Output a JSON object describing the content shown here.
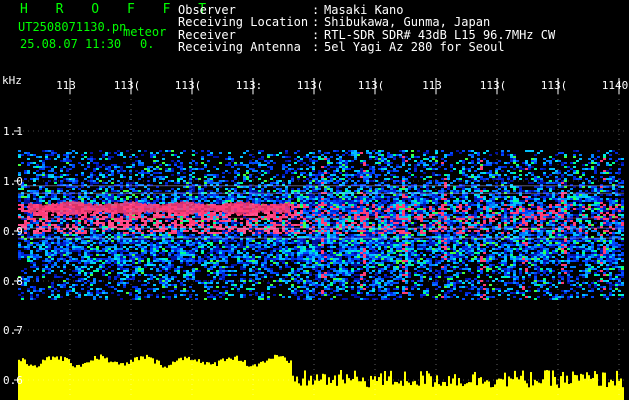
{
  "header": {
    "brand": "H R O F F T",
    "file_id": "UT2508071130.pn",
    "file_ext_tag": "meteor",
    "datetime": "25.08.07 11:30",
    "minor_count": "0."
  },
  "station": [
    {
      "label": "Observer",
      "value": "Masaki Kano"
    },
    {
      "label": "Receiving Location",
      "value": "Shibukawa, Gunma, Japan"
    },
    {
      "label": "Receiver",
      "value": "RTL-SDR SDR# 43dB L15 96.7MHz CW"
    },
    {
      "label": "Receiving Antenna",
      "value": "5el Yagi Az 280 for Seoul"
    }
  ],
  "separator": ":",
  "colors": {
    "header_accent": "#00ff00",
    "background": "#000000",
    "grid": "#ffffff",
    "echo_bar": "#ffff00",
    "spectrum_low": "#0018c8",
    "spectrum_mid": "#00e8e8",
    "spectrum_high": "#ff3c78"
  },
  "chart_data": {
    "type": "heatmap",
    "y_unit": "kHz",
    "y_ticks": [
      "1.1",
      "1.0",
      "0.9",
      "0.8",
      "0.7",
      "0.6"
    ],
    "time_ticks": [
      "113",
      "113(",
      "113(",
      "113:",
      "113(",
      "113(",
      "113",
      "113(",
      "113(",
      "1140"
    ],
    "grid": true,
    "notes": "Spectrogram of meteor echo: dense band near 0.9–1.0 kHz, yellow echo-power strip along bottom"
  }
}
